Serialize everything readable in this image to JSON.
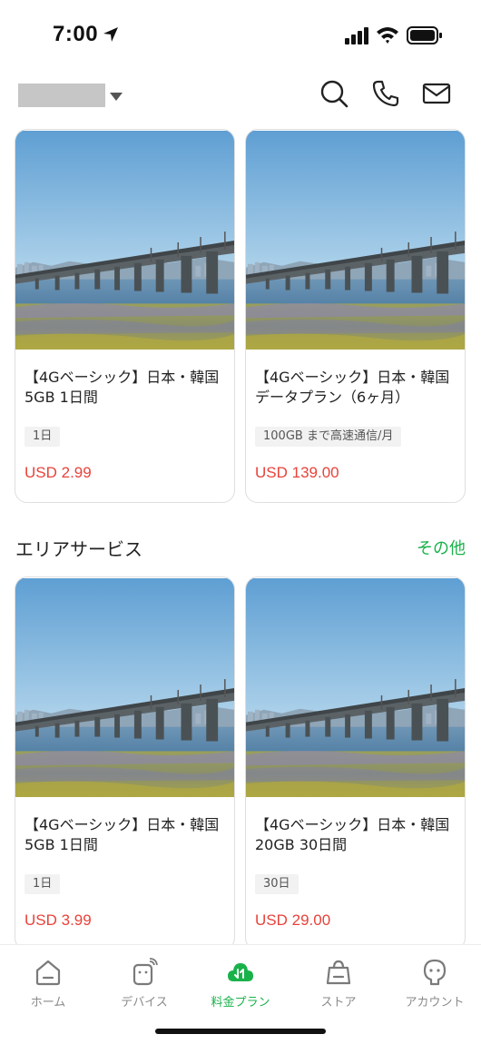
{
  "status_bar": {
    "time": "7:00"
  },
  "header": {},
  "cards_top": [
    {
      "title_line1": "【4Gベーシック】日本・韓国",
      "title_line2": "5GB 1日間",
      "tag": "1日",
      "price": "USD 2.99"
    },
    {
      "title_line1": "【4Gベーシック】日本・韓国",
      "title_line2": "データプラン（6ヶ月）",
      "tag": "100GB まで高速通信/月",
      "price": "USD 139.00"
    }
  ],
  "area_section": {
    "title": "エリアサービス",
    "more_label": "その他"
  },
  "cards_area": [
    {
      "title_line1": "【4Gベーシック】日本・韓国",
      "title_line2": "5GB 1日間",
      "tag": "1日",
      "price": "USD 3.99"
    },
    {
      "title_line1": "【4Gベーシック】日本・韓国",
      "title_line2": "20GB 30日間",
      "tag": "30日",
      "price": "USD 29.00"
    }
  ],
  "tabbar": {
    "items": [
      {
        "label": "ホーム",
        "icon": "home-icon"
      },
      {
        "label": "デバイス",
        "icon": "device-icon"
      },
      {
        "label": "料金プラン",
        "icon": "plan-icon",
        "active": true
      },
      {
        "label": "ストア",
        "icon": "store-icon"
      },
      {
        "label": "アカウント",
        "icon": "account-icon"
      }
    ]
  },
  "colors": {
    "accent": "#19b24a",
    "price": "#e8423a",
    "tag_bg": "#f2f2f2"
  }
}
